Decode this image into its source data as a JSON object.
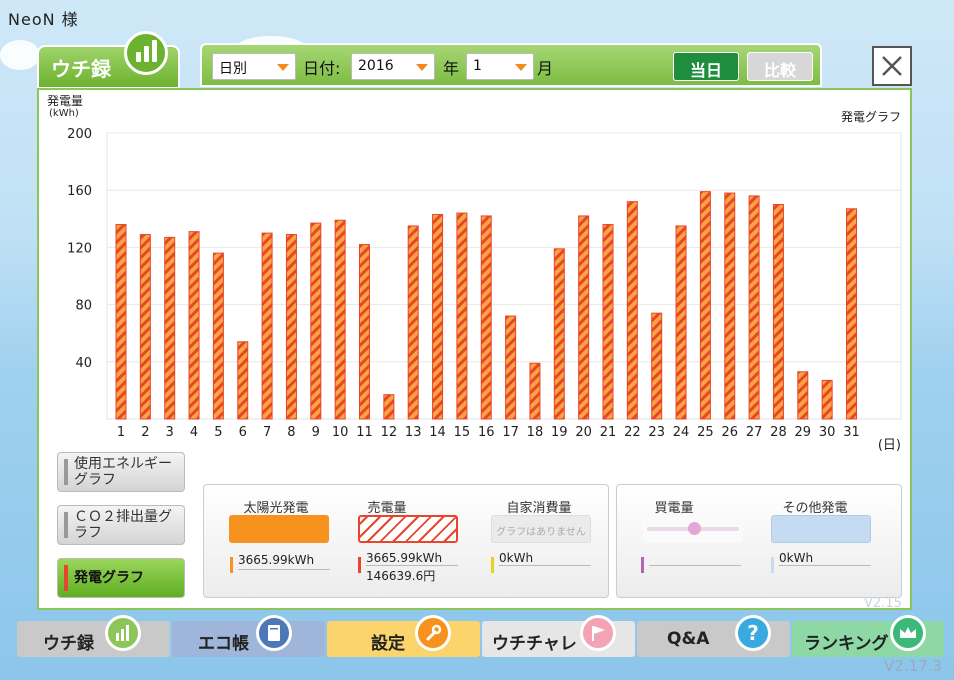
{
  "user": {
    "name": "NeoN 様"
  },
  "header_tab": {
    "label": "ウチ録"
  },
  "toolbar": {
    "mode": {
      "value": "日別"
    },
    "date_label": "日付:",
    "year": {
      "value": "2016"
    },
    "year_label": "年",
    "month": {
      "value": "1"
    },
    "month_label": "月",
    "today_button": "当日",
    "compare_button": "比較"
  },
  "chart_data": {
    "type": "bar",
    "title": "発電グラフ",
    "ylabel": "発電量",
    "yunit": "(kWh)",
    "xunit": "(日)",
    "ylim": [
      0,
      200
    ],
    "yticks": [
      200,
      160,
      120,
      80,
      40
    ],
    "grid": true,
    "categories": [
      "1",
      "2",
      "3",
      "4",
      "5",
      "6",
      "7",
      "8",
      "9",
      "10",
      "11",
      "12",
      "13",
      "14",
      "15",
      "16",
      "17",
      "18",
      "19",
      "20",
      "21",
      "22",
      "23",
      "24",
      "25",
      "26",
      "27",
      "28",
      "29",
      "30",
      "31"
    ],
    "values": [
      136,
      129,
      127,
      131,
      116,
      54,
      130,
      129,
      137,
      139,
      122,
      17,
      135,
      143,
      144,
      142,
      72,
      39,
      119,
      142,
      136,
      152,
      74,
      135,
      159,
      158,
      156,
      150,
      33,
      27,
      147
    ],
    "bar_color": "#f7921e",
    "stripe_color": "#e8452c"
  },
  "side_buttons": {
    "energy": "使用エネルギーグラフ",
    "co2": "ＣＯ２排出量グラフ",
    "generation": "発電グラフ"
  },
  "legend": {
    "solar": {
      "title": "太陽光発電",
      "value": "3665.99kWh",
      "color": "#f7921e"
    },
    "sold": {
      "title": "売電量",
      "value": "3665.99kWh",
      "value2": "146639.6円",
      "color": "#e8452c"
    },
    "self": {
      "title": "自家消費量",
      "placeholder": "グラフはありません",
      "value": "0kWh",
      "color": "#e8d21a"
    },
    "bought": {
      "title": "買電量",
      "value": "",
      "color": "#b266b2"
    },
    "other": {
      "title": "その他発電",
      "value": "0kWh",
      "color": "#c5dbf2"
    }
  },
  "nav": {
    "uchiroku": "ウチ録",
    "ecobook": "エコ帳",
    "settings": "設定",
    "challenge": "ウチチャレ",
    "qa": "Q&A",
    "ranking": "ランキング"
  },
  "version": "V2.17.3",
  "version_inner": "V2.15"
}
